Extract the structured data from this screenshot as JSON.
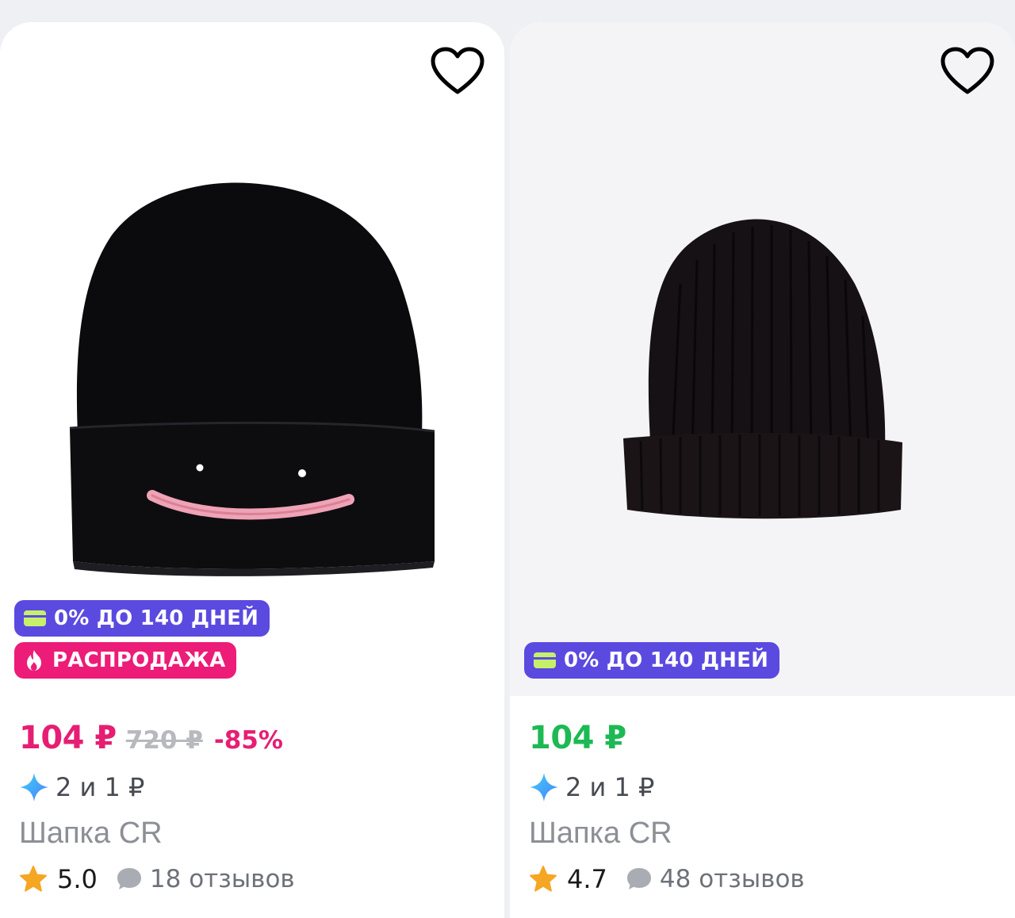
{
  "products": [
    {
      "installment_badge": "0% ДО 140 ДНЕЙ",
      "sale_badge": "РАСПРОДАЖА",
      "price": "104 ₽",
      "old_price": "720 ₽",
      "discount": "-85%",
      "bonus": "2 и 1 ₽",
      "title": "Шапка CR",
      "rating": "5.0",
      "reviews": "18 отзывов",
      "price_color": "#e61e73"
    },
    {
      "installment_badge": "0% ДО 140 ДНЕЙ",
      "price": "104 ₽",
      "bonus": "2 и 1 ₽",
      "title": "Шапка CR",
      "rating": "4.7",
      "reviews": "48 отзывов",
      "price_color": "#1db954"
    }
  ],
  "icons": {
    "favorite": "heart-outline-icon",
    "installment": "card-icon",
    "sale": "fire-icon",
    "bonus": "sparkle-icon",
    "rating": "star-icon",
    "reviews": "chat-bubble-icon"
  },
  "colors": {
    "installment_badge": "#5b4ae0",
    "sale_badge": "#ec1c78",
    "star": "#f5a623"
  }
}
